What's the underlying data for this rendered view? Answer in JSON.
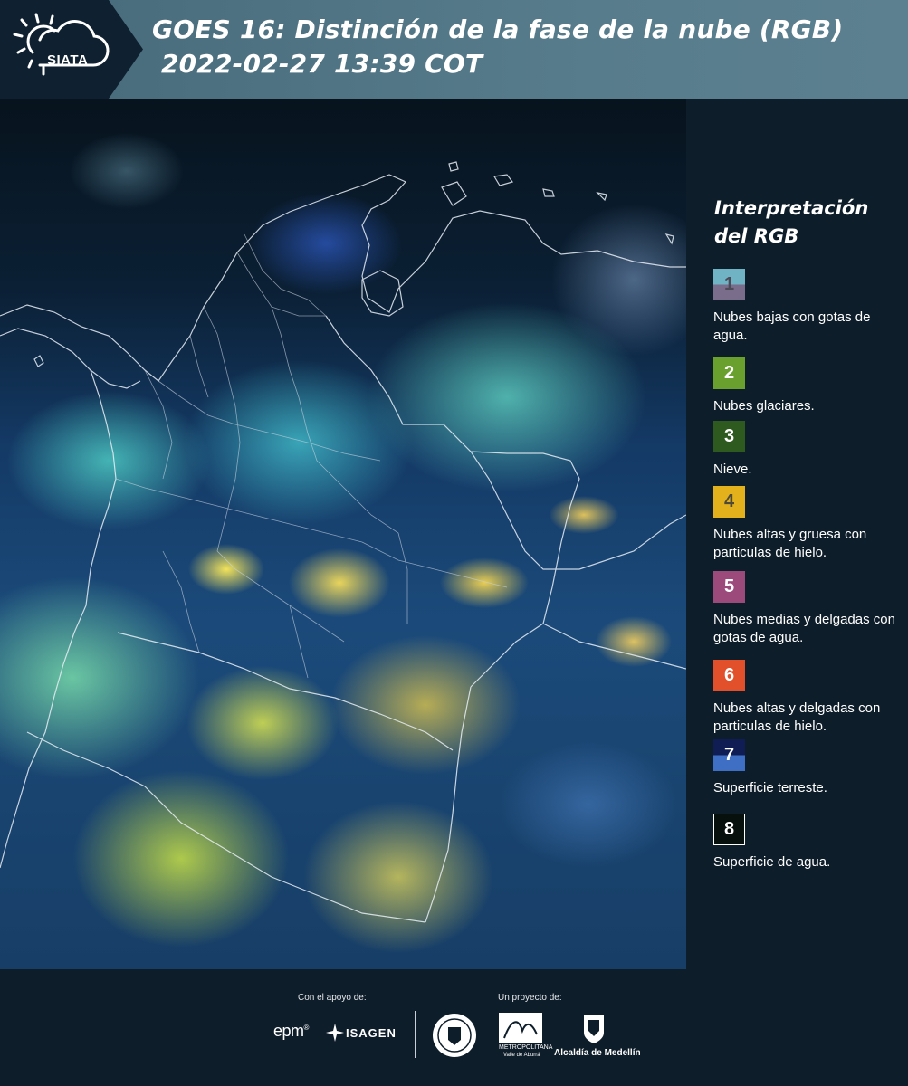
{
  "header": {
    "logo_text": "SIATA",
    "title_line1": "GOES 16: Distinción de la fase de la nube (RGB)",
    "title_line2": " 2022-02-27 13:39 COT"
  },
  "legend": {
    "title": "Interpretación del RGB",
    "items": [
      {
        "number": "1",
        "label": "Nubes bajas con gotas de agua.",
        "colors": [
          "#6fb3c4",
          "#7a6d8c"
        ],
        "text_color": "#4d4a57"
      },
      {
        "number": "2",
        "label": "Nubes glaciares.",
        "colors": [
          "#6aa02e"
        ],
        "text_color": "#ffffff"
      },
      {
        "number": "3",
        "label": "Nieve.",
        "colors": [
          "#2f5a1f"
        ],
        "text_color": "#ffffff"
      },
      {
        "number": "4",
        "label": "Nubes altas y gruesa con particulas de hielo.",
        "colors": [
          "#e2b11c"
        ],
        "text_color": "#4d4a3a"
      },
      {
        "number": "5",
        "label": "Nubes medias y delgadas con gotas de agua.",
        "colors": [
          "#9c4a7c"
        ],
        "text_color": "#ffffff"
      },
      {
        "number": "6",
        "label": "Nubes altas y delgadas con particulas de hielo.",
        "colors": [
          "#e1502a"
        ],
        "text_color": "#ffffff"
      },
      {
        "number": "7",
        "label": "Superficie terreste.",
        "colors": [
          "#101c54",
          "#3f6fc4"
        ],
        "text_color": "#ffffff"
      },
      {
        "number": "8",
        "label": "Superficie de agua.",
        "colors": [
          "#07100c"
        ],
        "text_color": "#ffffff"
      }
    ]
  },
  "footer": {
    "support_caption": "Con el apoyo de:",
    "project_caption": "Un proyecto de:",
    "sponsor_epm": "epm",
    "sponsor_isagen": "ISAGEN",
    "area_text": "METROPOLITANA",
    "area_subtext": "Valle de Aburrá",
    "alcaldia": "Alcaldía de Medellín"
  }
}
